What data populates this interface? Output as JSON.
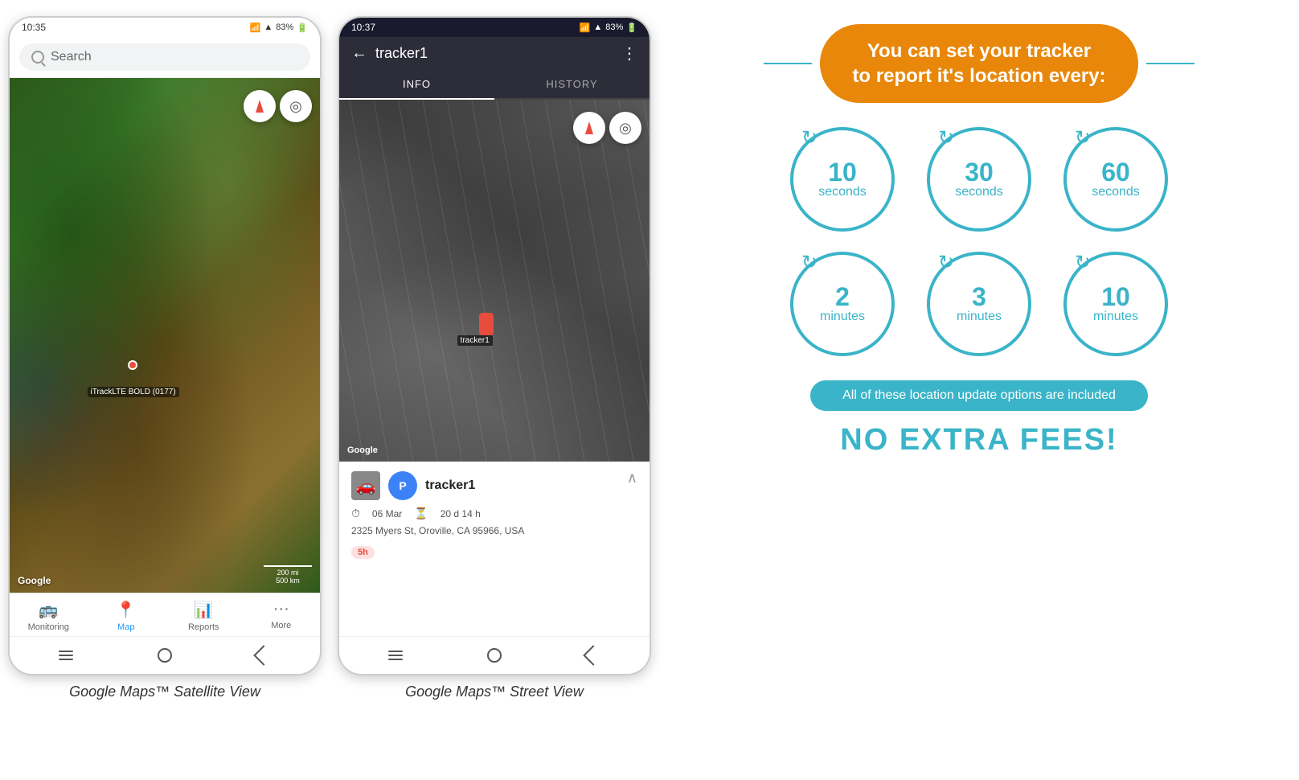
{
  "phone1": {
    "status_time": "10:35",
    "battery": "83%",
    "search_placeholder": "Search",
    "google_logo": "Google",
    "scale_200mi": "200 mi",
    "scale_500km": "500 km",
    "tracker_label": "iTrackLTE BOLD (0177)",
    "nav_items": [
      {
        "id": "monitoring",
        "label": "Monitoring",
        "icon": "🚌"
      },
      {
        "id": "map",
        "label": "Map",
        "icon": "📍",
        "active": true
      },
      {
        "id": "reports",
        "label": "Reports",
        "icon": "📊"
      },
      {
        "id": "more",
        "label": "More",
        "icon": "···"
      }
    ],
    "caption": "Google Maps™ Satellite View"
  },
  "phone2": {
    "status_time": "10:37",
    "battery": "83%",
    "title": "tracker1",
    "tabs": [
      {
        "label": "INFO",
        "active": true
      },
      {
        "label": "HISTORY",
        "active": false
      }
    ],
    "google_logo": "Google",
    "tracker_name": "tracker1",
    "date": "06 Mar",
    "duration": "20 d 14 h",
    "address": "2325 Myers St, Oroville, CA 95966, USA",
    "badge": "5h",
    "caption": "Google Maps™ Street View"
  },
  "infographic": {
    "title": "You can set your tracker\nto report it's location every:",
    "circles": [
      {
        "number": "10",
        "unit": "seconds"
      },
      {
        "number": "30",
        "unit": "seconds"
      },
      {
        "number": "60",
        "unit": "seconds"
      },
      {
        "number": "2",
        "unit": "minutes"
      },
      {
        "number": "3",
        "unit": "minutes"
      },
      {
        "number": "10",
        "unit": "minutes"
      }
    ],
    "no_fees_text": "All of these location update options are included",
    "no_extra_fees": "NO EXTRA FEES!"
  }
}
